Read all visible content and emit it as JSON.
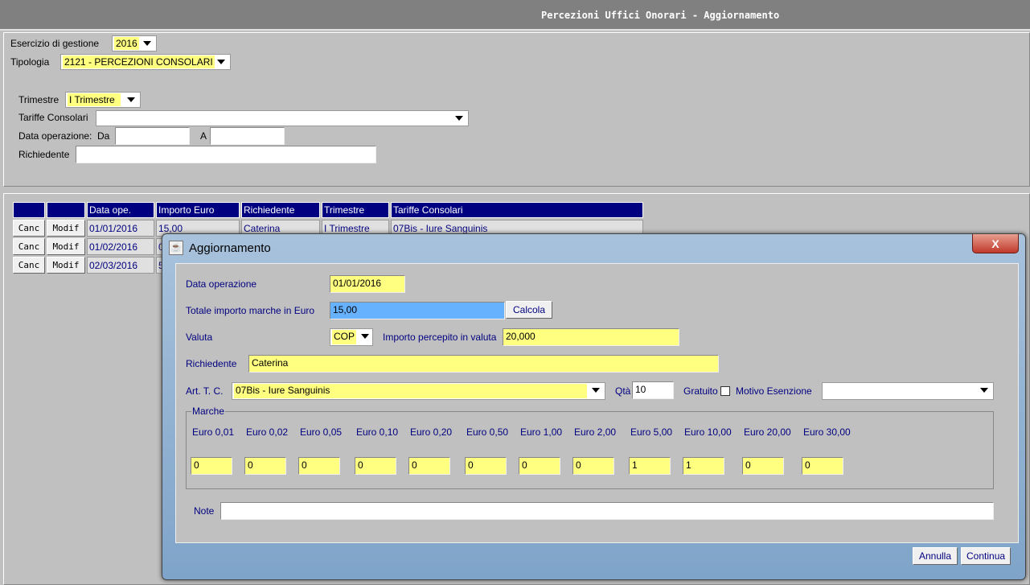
{
  "window": {
    "title": "Percezioni Uffici Onorari - Aggiornamento"
  },
  "filters": {
    "esercizio_label": "Esercizio di gestione",
    "esercizio_value": "2016",
    "tipologia_label": "Tipologia",
    "tipologia_value": "2121 - PERCEZIONI CONSOLARI",
    "trimestre_label": "Trimestre",
    "trimestre_value": "I Trimestre",
    "tariffe_label": "Tariffe Consolari",
    "tariffe_value": "",
    "data_label": "Data operazione:",
    "da_label": "Da",
    "a_label": "A",
    "da_value": "",
    "a_value": "",
    "richiedente_label": "Richiedente",
    "richiedente_value": ""
  },
  "table": {
    "headers": [
      "",
      "",
      "Data ope.",
      "Importo Euro",
      "Richiedente",
      "Trimestre",
      "Tariffe Consolari"
    ],
    "canc_label": "Canc",
    "modif_label": "Modif",
    "rows": [
      [
        "01/01/2016",
        "15,00",
        "Caterina",
        "I Trimestre",
        "07Bis - Iure Sanguinis"
      ],
      [
        "01/02/2016",
        "0",
        "",
        "",
        ""
      ],
      [
        "02/03/2016",
        "5",
        "",
        "",
        ""
      ]
    ]
  },
  "dialog": {
    "title": "Aggiornamento",
    "close_label": "X",
    "data_label": "Data operazione",
    "data_value": "01/01/2016",
    "totale_label": "Totale importo marche in Euro",
    "totale_value": "15,00",
    "calcola_label": "Calcola",
    "valuta_label": "Valuta",
    "valuta_value": "COP",
    "importo_label": "Importo percepito in valuta",
    "importo_value": "20,000",
    "richiedente_label": "Richiedente",
    "richiedente_value": "Caterina",
    "art_label": "Art. T. C.",
    "art_value": "07Bis - Iure Sanguinis",
    "qta_label": "Qtà",
    "qta_value": "10",
    "gratuito_label": "Gratuito",
    "gratuito_checked": false,
    "motivo_label": "Motivo Esenzione",
    "motivo_value": "",
    "marche_label": "Marche",
    "marche": [
      {
        "label": "Euro 0,01",
        "value": "0"
      },
      {
        "label": "Euro 0,02",
        "value": "0"
      },
      {
        "label": "Euro 0,05",
        "value": "0"
      },
      {
        "label": "Euro 0,10",
        "value": "0"
      },
      {
        "label": "Euro 0,20",
        "value": "0"
      },
      {
        "label": "Euro 0,50",
        "value": "0"
      },
      {
        "label": "Euro 1,00",
        "value": "0"
      },
      {
        "label": "Euro 2,00",
        "value": "0"
      },
      {
        "label": "Euro 5,00",
        "value": "1"
      },
      {
        "label": "Euro 10,00",
        "value": "1"
      },
      {
        "label": "Euro 20,00",
        "value": "0"
      },
      {
        "label": "Euro 30,00",
        "value": "0"
      }
    ],
    "note_label": "Note",
    "note_value": "",
    "annulla_label": "Annulla",
    "continua_label": "Continua"
  }
}
